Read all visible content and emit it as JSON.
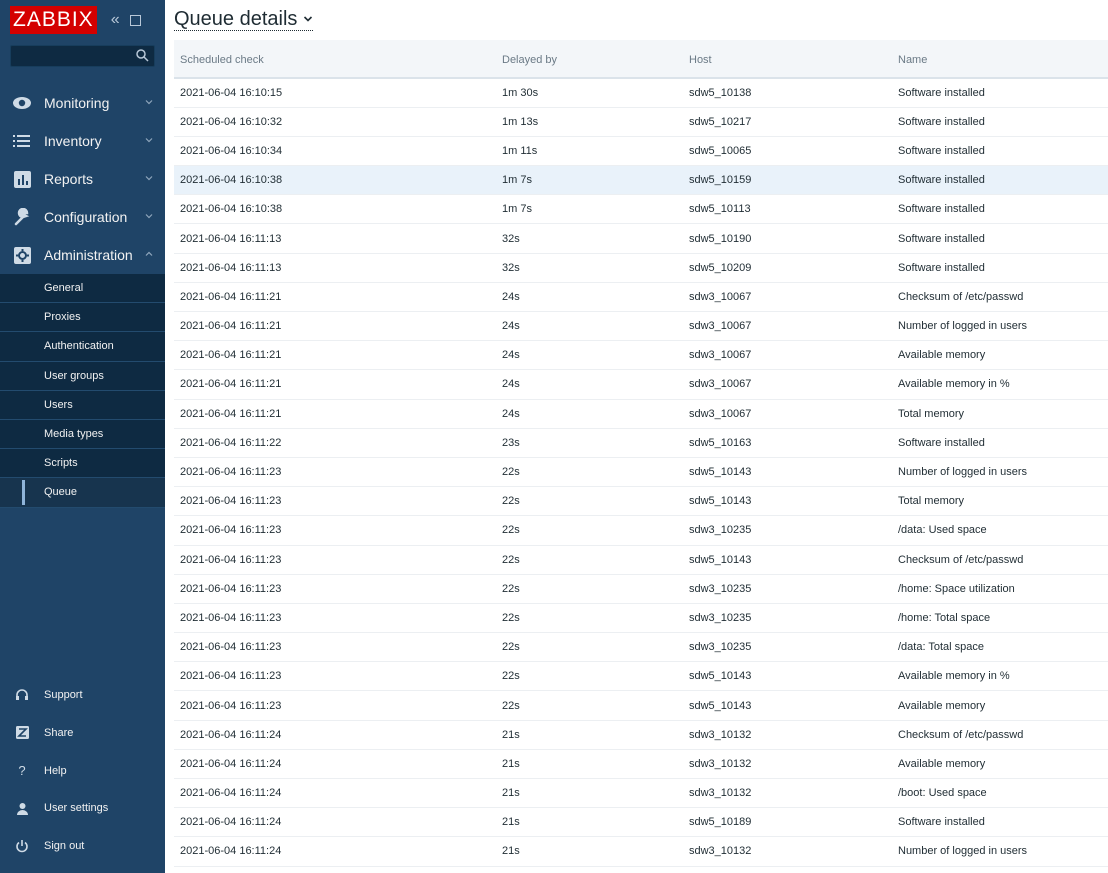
{
  "app": {
    "logo": "ZABBIX",
    "search": {
      "placeholder": "",
      "value": ""
    }
  },
  "sidebar": {
    "menu": [
      {
        "label": "Monitoring",
        "icon": "eye-icon"
      },
      {
        "label": "Inventory",
        "icon": "list-icon"
      },
      {
        "label": "Reports",
        "icon": "bar-chart-icon"
      },
      {
        "label": "Configuration",
        "icon": "wrench-icon"
      },
      {
        "label": "Administration",
        "icon": "gear-icon"
      }
    ],
    "submenu": [
      "General",
      "Proxies",
      "Authentication",
      "User groups",
      "Users",
      "Media types",
      "Scripts",
      "Queue"
    ],
    "submenu_selected": "Queue",
    "bottom": [
      {
        "label": "Support",
        "icon": "headset-icon"
      },
      {
        "label": "Share",
        "icon": "share-icon"
      },
      {
        "label": "Help",
        "icon": "help-icon"
      },
      {
        "label": "User settings",
        "icon": "user-icon"
      },
      {
        "label": "Sign out",
        "icon": "power-icon"
      }
    ]
  },
  "main": {
    "title": "Queue details",
    "columns": [
      "Scheduled check",
      "Delayed by",
      "Host",
      "Name"
    ],
    "rows": [
      [
        "2021-06-04 16:10:15",
        "1m 30s",
        "sdw5_10138",
        "Software installed"
      ],
      [
        "2021-06-04 16:10:32",
        "1m 13s",
        "sdw5_10217",
        "Software installed"
      ],
      [
        "2021-06-04 16:10:34",
        "1m 11s",
        "sdw5_10065",
        "Software installed"
      ],
      [
        "2021-06-04 16:10:38",
        "1m 7s",
        "sdw5_10159",
        "Software installed"
      ],
      [
        "2021-06-04 16:10:38",
        "1m 7s",
        "sdw5_10113",
        "Software installed"
      ],
      [
        "2021-06-04 16:11:13",
        "32s",
        "sdw5_10190",
        "Software installed"
      ],
      [
        "2021-06-04 16:11:13",
        "32s",
        "sdw5_10209",
        "Software installed"
      ],
      [
        "2021-06-04 16:11:21",
        "24s",
        "sdw3_10067",
        "Checksum of /etc/passwd"
      ],
      [
        "2021-06-04 16:11:21",
        "24s",
        "sdw3_10067",
        "Number of logged in users"
      ],
      [
        "2021-06-04 16:11:21",
        "24s",
        "sdw3_10067",
        "Available memory"
      ],
      [
        "2021-06-04 16:11:21",
        "24s",
        "sdw3_10067",
        "Available memory in %"
      ],
      [
        "2021-06-04 16:11:21",
        "24s",
        "sdw3_10067",
        "Total memory"
      ],
      [
        "2021-06-04 16:11:22",
        "23s",
        "sdw5_10163",
        "Software installed"
      ],
      [
        "2021-06-04 16:11:23",
        "22s",
        "sdw5_10143",
        "Number of logged in users"
      ],
      [
        "2021-06-04 16:11:23",
        "22s",
        "sdw5_10143",
        "Total memory"
      ],
      [
        "2021-06-04 16:11:23",
        "22s",
        "sdw3_10235",
        "/data: Used space"
      ],
      [
        "2021-06-04 16:11:23",
        "22s",
        "sdw5_10143",
        "Checksum of /etc/passwd"
      ],
      [
        "2021-06-04 16:11:23",
        "22s",
        "sdw3_10235",
        "/home: Space utilization"
      ],
      [
        "2021-06-04 16:11:23",
        "22s",
        "sdw3_10235",
        "/home: Total space"
      ],
      [
        "2021-06-04 16:11:23",
        "22s",
        "sdw3_10235",
        "/data: Total space"
      ],
      [
        "2021-06-04 16:11:23",
        "22s",
        "sdw5_10143",
        "Available memory in %"
      ],
      [
        "2021-06-04 16:11:23",
        "22s",
        "sdw5_10143",
        "Available memory"
      ],
      [
        "2021-06-04 16:11:24",
        "21s",
        "sdw3_10132",
        "Checksum of /etc/passwd"
      ],
      [
        "2021-06-04 16:11:24",
        "21s",
        "sdw3_10132",
        "Available memory"
      ],
      [
        "2021-06-04 16:11:24",
        "21s",
        "sdw3_10132",
        "/boot: Used space"
      ],
      [
        "2021-06-04 16:11:24",
        "21s",
        "sdw5_10189",
        "Software installed"
      ],
      [
        "2021-06-04 16:11:24",
        "21s",
        "sdw3_10132",
        "Number of logged in users"
      ]
    ],
    "highlighted_row": 3
  },
  "colors": {
    "sidebar_bg": "#1f4467",
    "submenu_bg": "#0e2a42",
    "logo_red": "#d40000",
    "row_highlight": "#e9f2fa"
  }
}
